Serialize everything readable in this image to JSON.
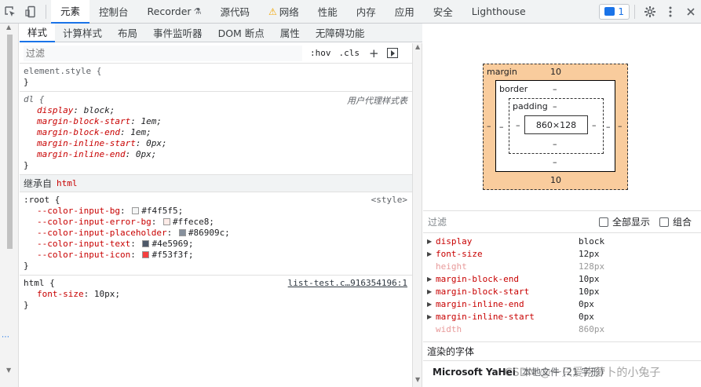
{
  "toolbar": {
    "tabs": [
      {
        "label": "元素"
      },
      {
        "label": "控制台"
      },
      {
        "label": "Recorder"
      },
      {
        "label": "源代码"
      },
      {
        "label": "网络"
      },
      {
        "label": "性能"
      },
      {
        "label": "内存"
      },
      {
        "label": "应用"
      },
      {
        "label": "安全"
      },
      {
        "label": "Lighthouse"
      }
    ],
    "issue_count": "1"
  },
  "subtabs": [
    {
      "label": "样式"
    },
    {
      "label": "计算样式"
    },
    {
      "label": "布局"
    },
    {
      "label": "事件监听器"
    },
    {
      "label": "DOM 断点"
    },
    {
      "label": "属性"
    },
    {
      "label": "无障碍功能"
    }
  ],
  "styles": {
    "filter_placeholder": "过滤",
    "hov": ":hov",
    "cls": ".cls",
    "element_style": "element.style {",
    "close_brace": "}",
    "dl_rule": {
      "selector": "dl {",
      "source": "用户代理样式表",
      "decls": [
        {
          "name": "display",
          "value": "block;"
        },
        {
          "name": "margin-block-start",
          "value": "1em;"
        },
        {
          "name": "margin-block-end",
          "value": "1em;"
        },
        {
          "name": "margin-inline-start",
          "value": "0px;"
        },
        {
          "name": "margin-inline-end",
          "value": "0px;"
        }
      ]
    },
    "inherited_label": "继承自",
    "inherited_tag": "html",
    "root_rule": {
      "selector": ":root {",
      "source": "<style>",
      "decls": [
        {
          "name": "--color-input-bg",
          "value": "#f4f5f5;",
          "swatch": "#f4f5f5"
        },
        {
          "name": "--color-input-error-bg",
          "value": "#ffece8;",
          "swatch": "#ffece8"
        },
        {
          "name": "--color-input-placeholder",
          "value": "#86909c;",
          "swatch": "#86909c"
        },
        {
          "name": "--color-input-text",
          "value": "#4e5969;",
          "swatch": "#4e5969"
        },
        {
          "name": "--color-input-icon",
          "value": "#f53f3f;",
          "swatch": "#f53f3f"
        }
      ]
    },
    "html_rule": {
      "selector": "html {",
      "source": "list-test.c…916354196:1",
      "decls": [
        {
          "name": "font-size",
          "value": "10px;"
        }
      ]
    }
  },
  "box_model": {
    "margin_label": "margin",
    "margin_top": "10",
    "margin_bottom": "10",
    "margin_left": "–",
    "margin_right": "–",
    "border_label": "border",
    "border_top": "–",
    "border_bottom": "–",
    "border_left": "–",
    "border_right": "–",
    "padding_label": "padding",
    "padding_top": "–",
    "padding_bottom": "–",
    "padding_left": "–",
    "padding_right": "–",
    "content": "860×128"
  },
  "computed": {
    "filter_placeholder": "过滤",
    "show_all": "全部显示",
    "group": "组合",
    "rows": [
      {
        "name": "display",
        "value": "block",
        "expandable": true
      },
      {
        "name": "font-size",
        "value": "12px",
        "expandable": true
      },
      {
        "name": "height",
        "value": "128px",
        "expandable": false
      },
      {
        "name": "margin-block-end",
        "value": "10px",
        "expandable": true
      },
      {
        "name": "margin-block-start",
        "value": "10px",
        "expandable": true
      },
      {
        "name": "margin-inline-end",
        "value": "0px",
        "expandable": true
      },
      {
        "name": "margin-inline-start",
        "value": "0px",
        "expandable": true
      },
      {
        "name": "width",
        "value": "860px",
        "expandable": false
      }
    ],
    "rendered_fonts_label": "渲染的字体",
    "font_name": "Microsoft YaHei",
    "font_source": "本地文件 (21 字形)"
  },
  "watermark": "CSDN @一只爱吃萝卜的小兔子"
}
